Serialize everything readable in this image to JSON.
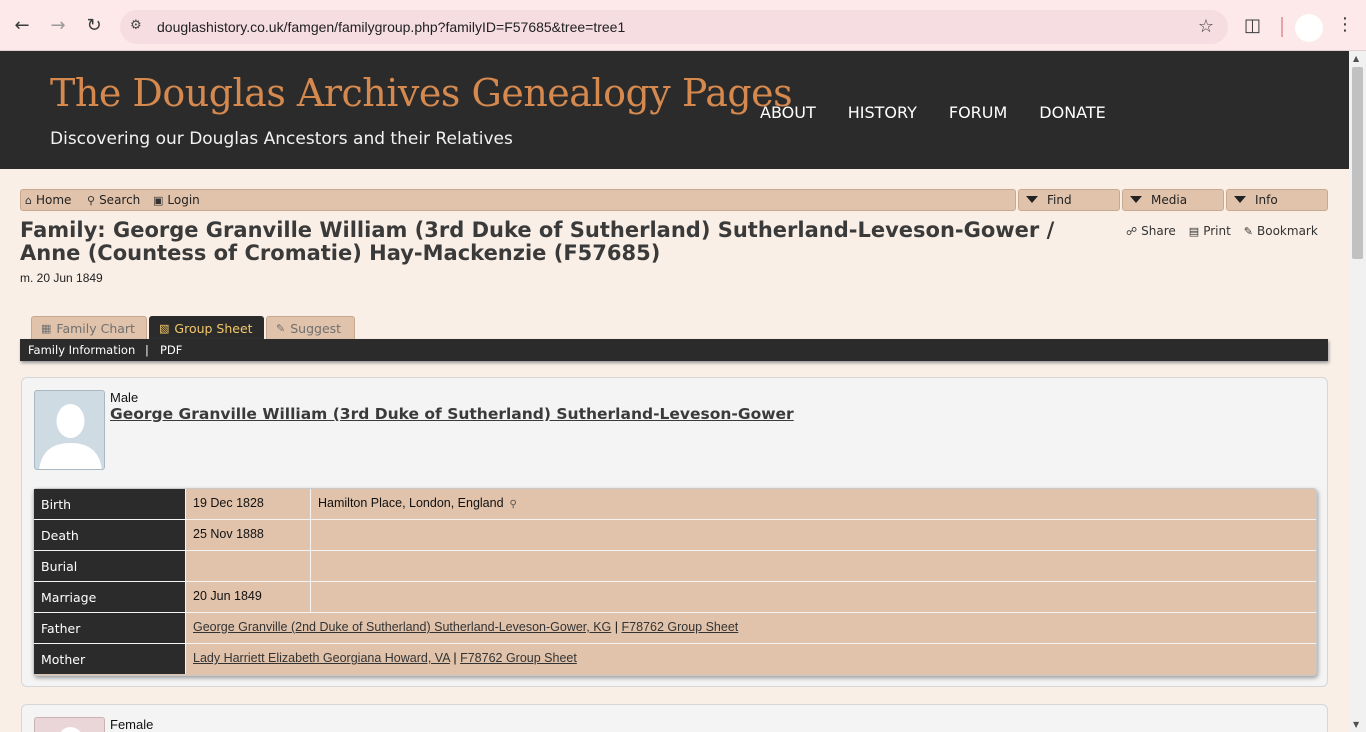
{
  "browser": {
    "url": "douglashistory.co.uk/famgen/familygroup.php?familyID=F57685&tree=tree1"
  },
  "site": {
    "title": "The Douglas Archives Genealogy Pages",
    "tagline": "Discovering our Douglas Ancestors and their Relatives",
    "nav": [
      "ABOUT",
      "HISTORY",
      "FORUM",
      "DONATE"
    ]
  },
  "menubar": {
    "home": "Home",
    "search": "Search",
    "login": "Login",
    "find": "Find",
    "media": "Media",
    "info": "Info"
  },
  "page": {
    "title": "Family: George Granville William (3rd Duke of Sutherland) Sutherland-Leveson-Gower / Anne (Countess of Cromatie) Hay-Mackenzie (F57685)",
    "marriage": "m. 20 Jun 1849",
    "actions": {
      "share": "Share",
      "print": "Print",
      "bookmark": "Bookmark"
    }
  },
  "tabs": {
    "family_chart": "Family Chart",
    "group_sheet": "Group Sheet",
    "suggest": "Suggest"
  },
  "subnav": {
    "family_information": "Family Information",
    "separator": "|",
    "pdf": "PDF"
  },
  "husband": {
    "gender": "Male",
    "name": "George Granville William (3rd Duke of Sutherland) Sutherland-Leveson-Gower",
    "events": {
      "birth": {
        "label": "Birth",
        "date": "19 Dec 1828",
        "place": "Hamilton Place, London, England"
      },
      "death": {
        "label": "Death",
        "date": "25 Nov 1888",
        "place": ""
      },
      "burial": {
        "label": "Burial",
        "date": "",
        "place": ""
      },
      "marriage": {
        "label": "Marriage",
        "date": "20 Jun 1849",
        "place": ""
      }
    },
    "father": {
      "label": "Father",
      "name": "George Granville (2nd Duke of Sutherland) Sutherland-Leveson-Gower, KG",
      "separator": "|",
      "group_sheet": "F78762 Group Sheet"
    },
    "mother": {
      "label": "Mother",
      "name": "Lady Harriett Elizabeth Georgiana Howard, VA",
      "separator": "|",
      "group_sheet": "F78762 Group Sheet"
    }
  },
  "wife": {
    "gender": "Female"
  },
  "icons": {
    "back": "back-arrow-icon",
    "forward": "forward-arrow-icon",
    "reload": "reload-icon",
    "site_info": "site-info-icon",
    "bookmark_star": "star-icon",
    "extensions": "puzzle-icon",
    "menu": "kebab-menu-icon"
  }
}
